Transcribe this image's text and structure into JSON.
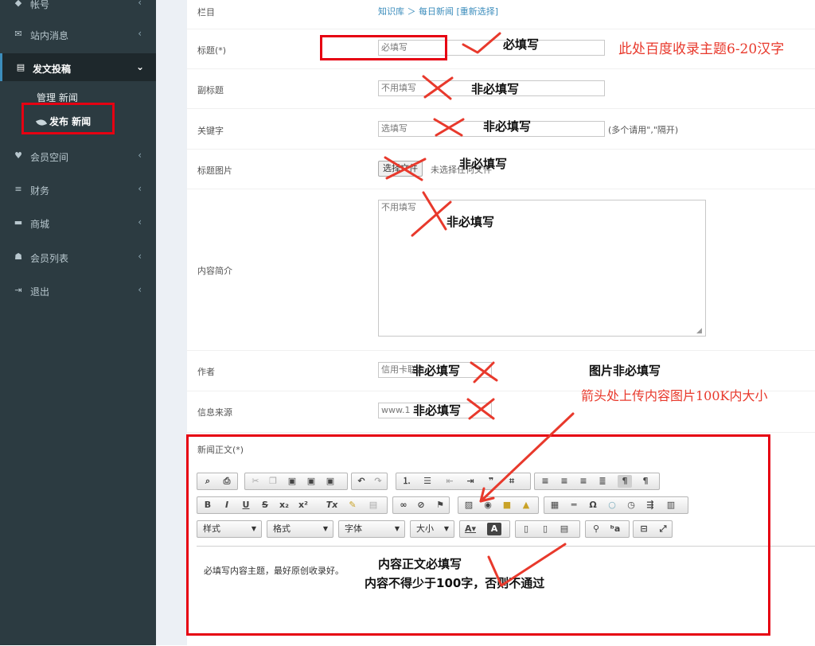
{
  "sidebar": {
    "items": [
      {
        "label": "帐号",
        "icon": "tag-icon"
      },
      {
        "label": "站内消息",
        "icon": "envelope-icon"
      },
      {
        "label": "发文投稿",
        "icon": "document-icon"
      },
      {
        "label": "会员空间",
        "icon": "heart-icon"
      },
      {
        "label": "财务",
        "icon": "database-icon"
      },
      {
        "label": "商城",
        "icon": "car-icon"
      },
      {
        "label": "会员列表",
        "icon": "users-icon"
      },
      {
        "label": "退出",
        "icon": "sign-out-icon"
      }
    ],
    "submenu": [
      {
        "label": "管理 新闻"
      },
      {
        "label": "发布 新闻",
        "icon": "leaf-icon"
      }
    ]
  },
  "form": {
    "column": {
      "label": "栏目",
      "path": "知识库 ＞ 每日新闻",
      "reselect": "[重新选择]"
    },
    "title": {
      "label": "标题(*)",
      "value": "必填写"
    },
    "subtitle": {
      "label": "副标题",
      "value": "不用填写"
    },
    "keywords": {
      "label": "关键字",
      "value": "选填写",
      "hint": "(多个请用\",\"隔开)"
    },
    "title_image": {
      "label": "标题图片",
      "button": "选择文件",
      "status": "未选择任何文件"
    },
    "summary": {
      "label": "内容简介",
      "value": "不用填写"
    },
    "author": {
      "label": "作者",
      "value": "信用卡联合"
    },
    "source": {
      "label": "信息来源",
      "value": "www.1"
    },
    "body": {
      "label": "新闻正文(*)",
      "content": "必填写内容主题，最好原创收录好。"
    }
  },
  "editor": {
    "combos": [
      {
        "label": "样式"
      },
      {
        "label": "格式"
      },
      {
        "label": "字体"
      },
      {
        "label": "大小"
      }
    ]
  },
  "annotations": {
    "required": "必填写",
    "baidu_note": "此处百度收录主题6-20汉字",
    "optional": "非必填写",
    "image_optional": "图片非必填写",
    "upload_note": "箭头处上传内容图片100K内大小",
    "body_required": "内容正文必填写",
    "body_min": "内容不得少于100字，否则不通过"
  },
  "colors": {
    "sidebar_bg": "#2c3b41",
    "sidebar_active_bg": "#1e282c",
    "annotation_red": "#e60012",
    "link_blue": "#3c8dbc"
  }
}
